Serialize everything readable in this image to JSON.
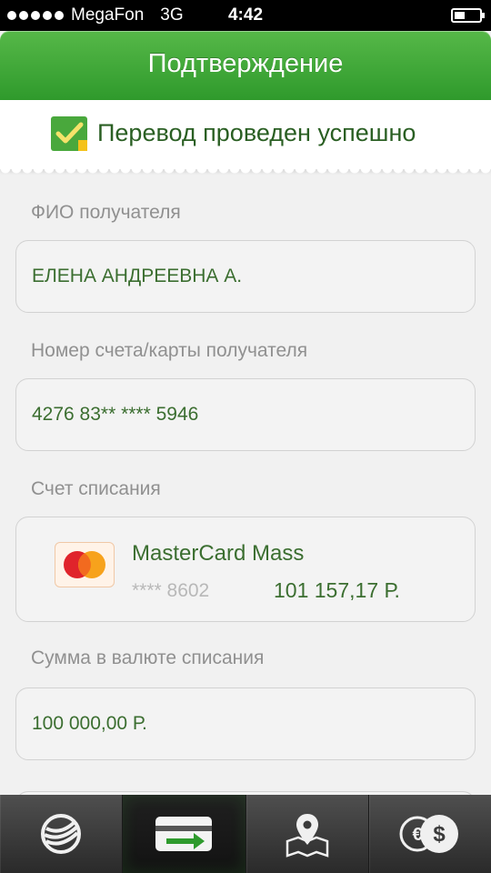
{
  "status_bar": {
    "carrier": "MegaFon",
    "network": "3G",
    "time": "4:42",
    "signal_bars": 5
  },
  "header": {
    "title": "Подтверждение"
  },
  "banner": {
    "text": "Перевод проведен успешно",
    "icon": "success-check-icon"
  },
  "fields": {
    "recipient_label": "ФИО получателя",
    "recipient_value": "ЕЛЕНА АНДРЕЕВНА А.",
    "account_label": "Номер счета/карты получателя",
    "account_value": "4276 83** **** 5946",
    "debit_label": "Счет списания",
    "amount_label": "Сумма в валюте списания",
    "amount_value": "100 000,00 Р."
  },
  "debit_card": {
    "logo_text": "MasterCard",
    "name": "MasterCard Mass",
    "number": "**** 8602",
    "balance": "101 157,17 Р."
  },
  "tab_bar": {
    "tabs": [
      {
        "icon": "sberbank-logo-icon",
        "active": false
      },
      {
        "icon": "card-transfer-icon",
        "active": true
      },
      {
        "icon": "map-pin-icon",
        "active": false
      },
      {
        "icon": "currency-exchange-icon",
        "active": false
      }
    ]
  },
  "colors": {
    "header_green": "#3fa83a",
    "value_green": "#3b6e30",
    "label_gray": "#909090"
  }
}
